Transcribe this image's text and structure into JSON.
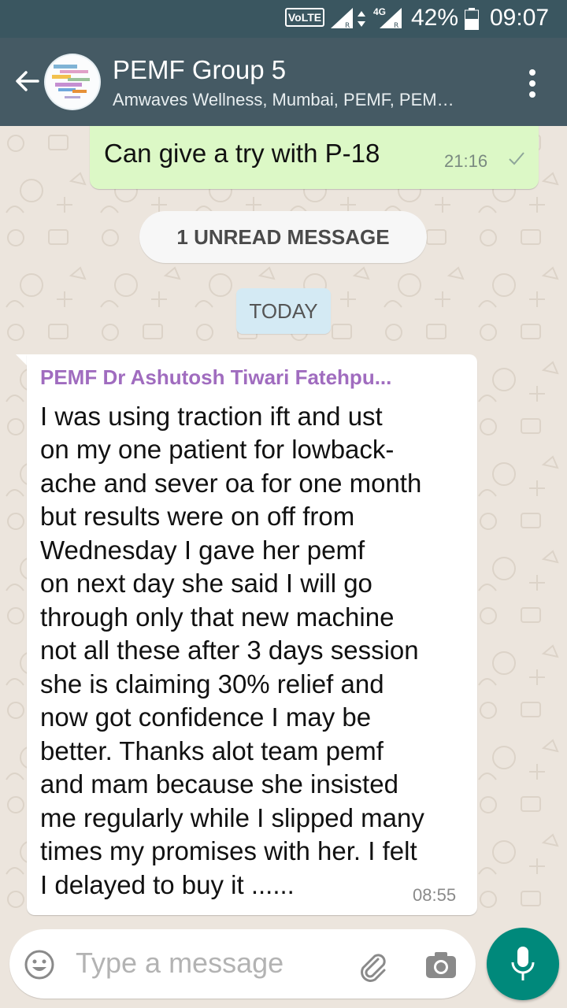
{
  "status_bar": {
    "volte": "VoLTE",
    "network": "4G",
    "battery": "42%",
    "time": "09:07"
  },
  "header": {
    "title": "PEMF Group 5",
    "subtitle": "Amwaves Wellness, Mumbai, PEMF, PEM…",
    "icons": [
      "back-arrow-icon",
      "group-avatar",
      "more-vert-icon"
    ]
  },
  "chat": {
    "outgoing": {
      "text": "Can give a try with P-18",
      "time": "21:16"
    },
    "unread_banner": "1 UNREAD MESSAGE",
    "date_chip": "TODAY",
    "incoming": {
      "sender": "PEMF Dr Ashutosh Tiwari Fatehpu...",
      "sender_color": "#a06cbf",
      "lines": [
        "I was using traction ift and ust",
        "on my one patient for lowback-",
        "ache and sever oa for one month",
        "but results were on off from",
        "Wednesday I gave her pemf",
        "on next day she said I will go",
        "through only that new machine",
        "not all these after 3 days session",
        "she is claiming 30% relief and",
        "now got confidence I may be",
        "better.  Thanks alot team pemf",
        "and mam because she insisted",
        "me regularly while I slipped many",
        "times my promises with her. I felt",
        "I delayed to buy it ......"
      ],
      "time": "08:55"
    }
  },
  "composer": {
    "placeholder": "Type a message",
    "accent": "#00897b",
    "icons": [
      "emoji-icon",
      "attach-icon",
      "camera-icon",
      "mic-icon"
    ]
  }
}
